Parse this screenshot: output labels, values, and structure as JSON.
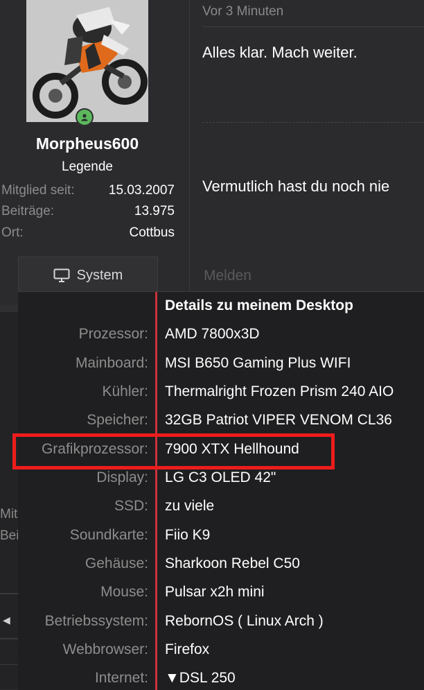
{
  "profile": {
    "username": "Morpheus600",
    "rank": "Legende",
    "stats": [
      {
        "label": "Mitglied seit:",
        "value": "15.03.2007"
      },
      {
        "label": "Beiträge:",
        "value": "13.975"
      },
      {
        "label": "Ort:",
        "value": "Cottbus"
      }
    ],
    "system_button": "System",
    "online_color": "#5cb85c"
  },
  "post": {
    "time": "Vor 3 Minuten",
    "text1": "Alles klar. Mach weiter.",
    "text2": "Vermutlich hast du noch nie",
    "report_label": "Melden"
  },
  "lower_peek": {
    "line1": "Mitglied seit:",
    "line2": "Beiträge:"
  },
  "system_popup": {
    "title": "Details zu meinem Desktop",
    "accent_color": "#c9333a",
    "highlight_color": "#ee1c1c",
    "highlighted_row": "Grafikprozessor:",
    "rows": [
      {
        "label": "Prozessor:",
        "value": "AMD 7800x3D"
      },
      {
        "label": "Mainboard:",
        "value": "MSI B650 Gaming Plus WIFI"
      },
      {
        "label": "Kühler:",
        "value": "Thermalright Frozen Prism 240 AIO"
      },
      {
        "label": "Speicher:",
        "value": "32GB Patriot VIPER VENOM CL36"
      },
      {
        "label": "Grafikprozessor:",
        "value": "7900 XTX Hellhound"
      },
      {
        "label": "Display:",
        "value": "LG C3 OLED 42\""
      },
      {
        "label": "SSD:",
        "value": "zu viele"
      },
      {
        "label": "Soundkarte:",
        "value": "Fiio K9"
      },
      {
        "label": "Gehäuse:",
        "value": "Sharkoon Rebel C50"
      },
      {
        "label": "Mouse:",
        "value": "Pulsar x2h mini"
      },
      {
        "label": "Betriebssystem:",
        "value": "RebornOS ( Linux Arch )"
      },
      {
        "label": "Webbrowser:",
        "value": "Firefox"
      },
      {
        "label": "Internet:",
        "value": "▼DSL 250"
      }
    ]
  }
}
